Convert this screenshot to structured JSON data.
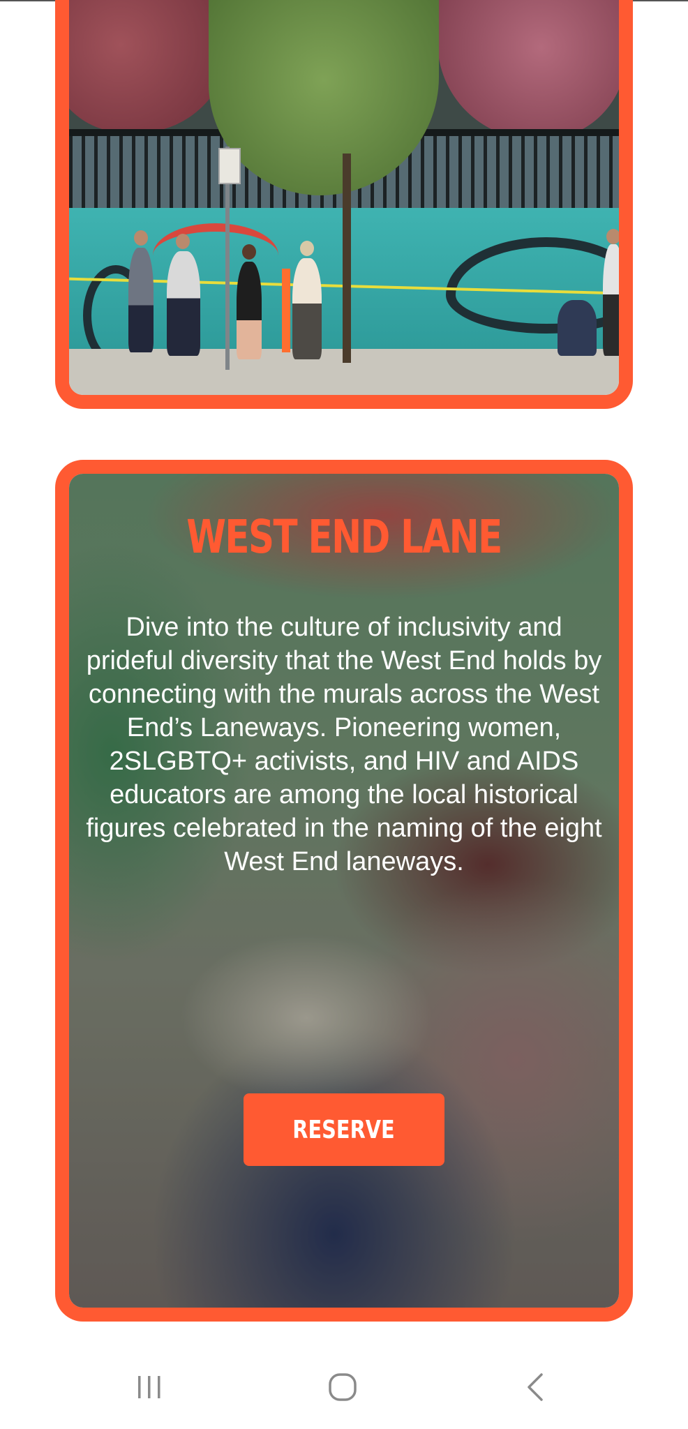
{
  "lane_card": {
    "title": "WEST END LANE",
    "description": "Dive into the culture of inclusivity and prideful diversity that the West End holds by connecting with the murals across the West End’s Laneways. Pioneering women, 2SLGBTQ+ activists, and HIV and AIDS educators are among the local historical figures celebrated in the naming of the eight West End laneways.",
    "reserve_label": "RESERVE"
  },
  "colors": {
    "accent": "#ff5a32",
    "text_on_image": "#ffffff",
    "page_background": "#ffffff",
    "nav_icon": "#8a8a8a"
  },
  "nav_bar": {
    "icons": [
      "recent-apps-icon",
      "home-icon",
      "back-icon"
    ]
  }
}
